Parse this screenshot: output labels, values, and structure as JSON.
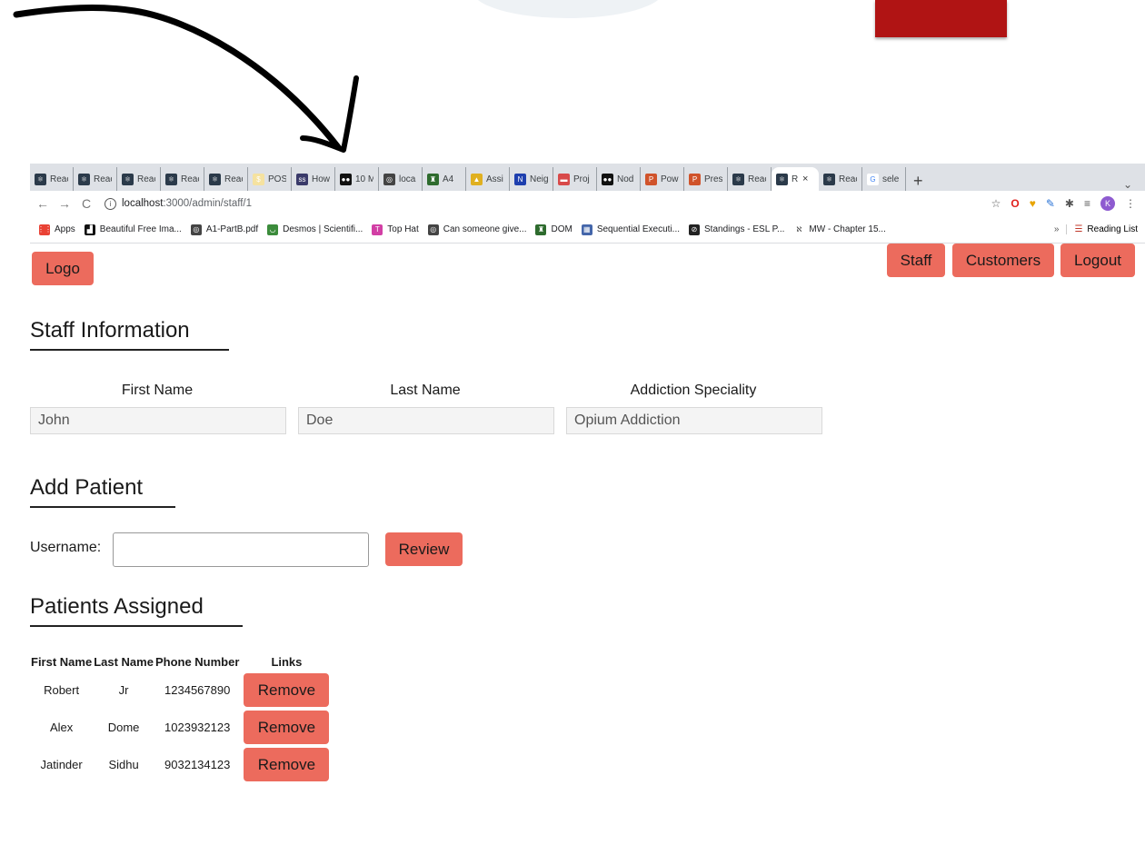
{
  "browser": {
    "tabs": [
      {
        "label": "Reac",
        "fav_color": "#2b3a4a",
        "fav_glyph": "⚛"
      },
      {
        "label": "Reac",
        "fav_color": "#2b3a4a",
        "fav_glyph": "⚛"
      },
      {
        "label": "Reac",
        "fav_color": "#2b3a4a",
        "fav_glyph": "⚛"
      },
      {
        "label": "Reac",
        "fav_color": "#2b3a4a",
        "fav_glyph": "⚛"
      },
      {
        "label": "Reac",
        "fav_color": "#2b3a4a",
        "fav_glyph": "⚛"
      },
      {
        "label": "POS",
        "fav_color": "#f5e2a0",
        "fav_glyph": "$"
      },
      {
        "label": "How",
        "fav_color": "#3a3a6a",
        "fav_glyph": "ss"
      },
      {
        "label": "10 M",
        "fav_color": "#111111",
        "fav_glyph": "●●"
      },
      {
        "label": "loca",
        "fav_color": "#444444",
        "fav_glyph": "◎"
      },
      {
        "label": "A4",
        "fav_color": "#2e6b2e",
        "fav_glyph": "♜"
      },
      {
        "label": "Assi",
        "fav_color": "#e0b020",
        "fav_glyph": "▲"
      },
      {
        "label": "Neig",
        "fav_color": "#1e3fae",
        "fav_glyph": "N"
      },
      {
        "label": "Proj",
        "fav_color": "#d84a4a",
        "fav_glyph": "▬"
      },
      {
        "label": "Nod",
        "fav_color": "#111111",
        "fav_glyph": "●●"
      },
      {
        "label": "Pow",
        "fav_color": "#d0532b",
        "fav_glyph": "P"
      },
      {
        "label": "Pres",
        "fav_color": "#d0532b",
        "fav_glyph": "P"
      },
      {
        "label": "Reac",
        "fav_color": "#2b3a4a",
        "fav_glyph": "⚛"
      },
      {
        "label": "R",
        "fav_color": "#2b3a4a",
        "fav_glyph": "⚛",
        "active": true
      },
      {
        "label": "Reac",
        "fav_color": "#2b3a4a",
        "fav_glyph": "⚛"
      },
      {
        "label": "sele",
        "fav_color": "#ffffff",
        "fav_glyph": "G"
      }
    ],
    "new_tab": "+",
    "tab_menu": "⌄",
    "url_host": "localhost",
    "url_path": ":3000/admin/staff/1",
    "profile_initial": "K",
    "bookmarks": [
      {
        "label": "Apps",
        "color": "#e94235",
        "glyph": "⋮⋮"
      },
      {
        "label": "Beautiful Free Ima...",
        "color": "#111111",
        "glyph": "▟"
      },
      {
        "label": "A1-PartB.pdf",
        "color": "#444444",
        "glyph": "◎"
      },
      {
        "label": "Desmos | Scientifi...",
        "color": "#3c8c3c",
        "glyph": "◡"
      },
      {
        "label": "Top Hat",
        "color": "#d23fa5",
        "glyph": "T"
      },
      {
        "label": "Can someone give...",
        "color": "#444444",
        "glyph": "◎"
      },
      {
        "label": "DOM",
        "color": "#2e6b2e",
        "glyph": "♜"
      },
      {
        "label": "Sequential Executi...",
        "color": "#4466aa",
        "glyph": "▦"
      },
      {
        "label": "Standings - ESL P...",
        "color": "#222222",
        "glyph": "⊘"
      },
      {
        "label": "MW - Chapter 15...",
        "color": "#ffffff",
        "glyph": "ℵ"
      }
    ],
    "bookmarks_more": "»",
    "reading_list": "Reading List"
  },
  "nav": {
    "logo": "Logo",
    "staff": "Staff",
    "customers": "Customers",
    "logout": "Logout"
  },
  "staff_info": {
    "heading": "Staff Information",
    "first_name_label": "First Name",
    "last_name_label": "Last Name",
    "speciality_label": "Addiction Speciality",
    "first_name": "John",
    "last_name": "Doe",
    "speciality": "Opium Addiction"
  },
  "add_patient": {
    "heading": "Add Patient",
    "username_label": "Username:",
    "username_value": "",
    "review_button": "Review"
  },
  "patients": {
    "heading": "Patients Assigned",
    "columns": [
      "First Name",
      "Last Name",
      "Phone Number",
      "Links"
    ],
    "rows": [
      {
        "first": "Robert",
        "last": "Jr",
        "phone": "1234567890",
        "action": "Remove"
      },
      {
        "first": "Alex",
        "last": "Dome",
        "phone": "1023932123",
        "action": "Remove"
      },
      {
        "first": "Jatinder",
        "last": "Sidhu",
        "phone": "9032134123",
        "action": "Remove"
      }
    ]
  },
  "colors": {
    "button": "#ec6b5d",
    "top_box": "#b01414"
  }
}
